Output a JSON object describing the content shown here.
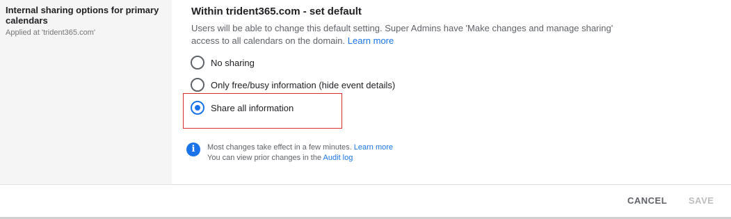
{
  "setting": {
    "title": "Internal sharing options for primary calendars",
    "applied_at": "Applied at 'trident365.com'"
  },
  "section": {
    "title": "Within trident365.com - set default",
    "description": "Users will be able to change this default setting. Super Admins have 'Make changes and manage sharing' access to all calendars on the domain.",
    "learn_more": "Learn more"
  },
  "options": [
    {
      "label": "No sharing",
      "checked": false
    },
    {
      "label": "Only free/busy information (hide event details)",
      "checked": false
    },
    {
      "label": "Share all information",
      "checked": true
    }
  ],
  "info": {
    "line1": "Most changes take effect in a few minutes.",
    "learn_more": "Learn more",
    "line2": "You can view prior changes in the",
    "audit_log": "Audit log"
  },
  "footer": {
    "cancel": "CANCEL",
    "save": "SAVE"
  },
  "colors": {
    "accent": "#1a73e8",
    "highlight": "#d92d2d"
  }
}
